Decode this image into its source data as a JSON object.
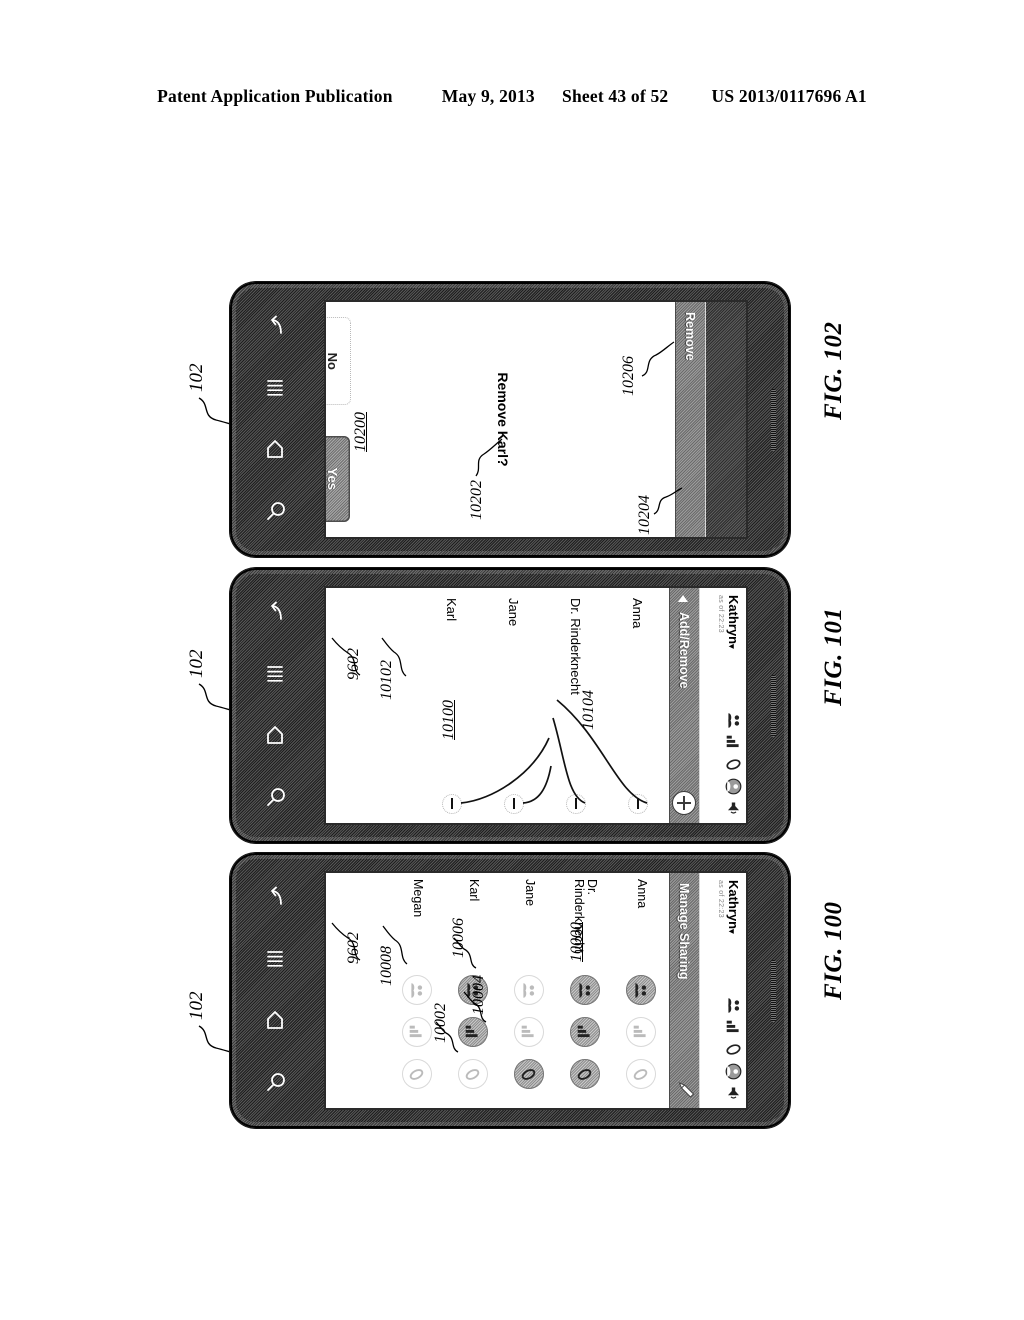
{
  "header": {
    "left": "Patent Application Publication",
    "date": "May 9, 2013",
    "sheet": "Sheet 43 of 52",
    "patent_number": "US 2013/0117696 A1"
  },
  "device_ref": "102",
  "status_bar": {
    "user_name": "Kathryn",
    "caret": "▾",
    "sub_text": "as of 22:23",
    "icons": [
      "people-icon",
      "bar-chart-icon",
      "pill-icon",
      "avatar-icon",
      "speaker-icon"
    ],
    "avatar_ref": "9602"
  },
  "nav_icons": [
    "back-icon",
    "menu-icon",
    "home-icon",
    "search-icon"
  ],
  "figures": [
    {
      "id": "fig102",
      "label": "FIG. 102",
      "screen_ref": "10200",
      "title": "Remove",
      "message": "Remove Karl?",
      "message_ref": "10202",
      "buttons": [
        {
          "label": "No",
          "ref": "10204",
          "style": "outline"
        },
        {
          "label": "Yes",
          "ref": "10206",
          "style": "filled"
        }
      ]
    },
    {
      "id": "fig101",
      "label": "FIG. 101",
      "screen_ref": "10100",
      "title": "Add/Remove",
      "add_button_ref": "10102",
      "add_button_label": "+",
      "connector_ref": "10104",
      "rows": [
        {
          "name": "Anna",
          "marked": true
        },
        {
          "name": "Dr. Rinderknecht",
          "marked": true
        },
        {
          "name": "Jane",
          "marked": true
        },
        {
          "name": "Karl",
          "marked": true
        }
      ]
    },
    {
      "id": "fig100",
      "label": "FIG. 100",
      "screen_ref": "10000",
      "title": "Manage Sharing",
      "title_ref": "10008",
      "edit_icon": "pencil-icon",
      "cell_refs": {
        "people": "10002",
        "chart": "10004",
        "pill": "10006"
      },
      "columns": [
        "people-icon",
        "bar-chart-icon",
        "pill-icon"
      ],
      "rows": [
        {
          "name": "Anna",
          "states": [
            "on",
            "off",
            "off"
          ]
        },
        {
          "name": "Dr. Rinderknecht",
          "states": [
            "on",
            "on",
            "on"
          ]
        },
        {
          "name": "Jane",
          "states": [
            "off",
            "off",
            "on"
          ]
        },
        {
          "name": "Karl",
          "states": [
            "on",
            "on",
            "off"
          ]
        },
        {
          "name": "Megan",
          "states": [
            "off",
            "off",
            "off"
          ]
        }
      ]
    }
  ]
}
